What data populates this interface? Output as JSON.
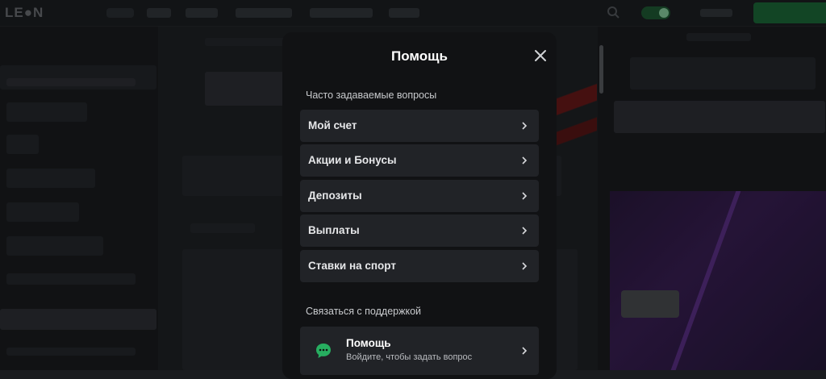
{
  "modal": {
    "title": "Помощь",
    "faq_section_label": "Часто задаваемые вопросы",
    "faq_items": [
      {
        "label": "Мой счет"
      },
      {
        "label": "Акции и Бонусы"
      },
      {
        "label": "Депозиты"
      },
      {
        "label": "Выплаты"
      },
      {
        "label": "Ставки на спорт"
      }
    ],
    "contact_section_label": "Связаться с поддержкой",
    "support": {
      "title": "Помощь",
      "subtitle": "Войдите, чтобы задать вопрос"
    }
  },
  "colors": {
    "accent": "#1d6b3a",
    "chat_icon": "#27ae60",
    "modal_bg": "#111214",
    "item_bg": "#212327"
  },
  "icons": [
    "close-icon",
    "chevron-right-icon",
    "chat-bubble-icon",
    "search-icon"
  ]
}
